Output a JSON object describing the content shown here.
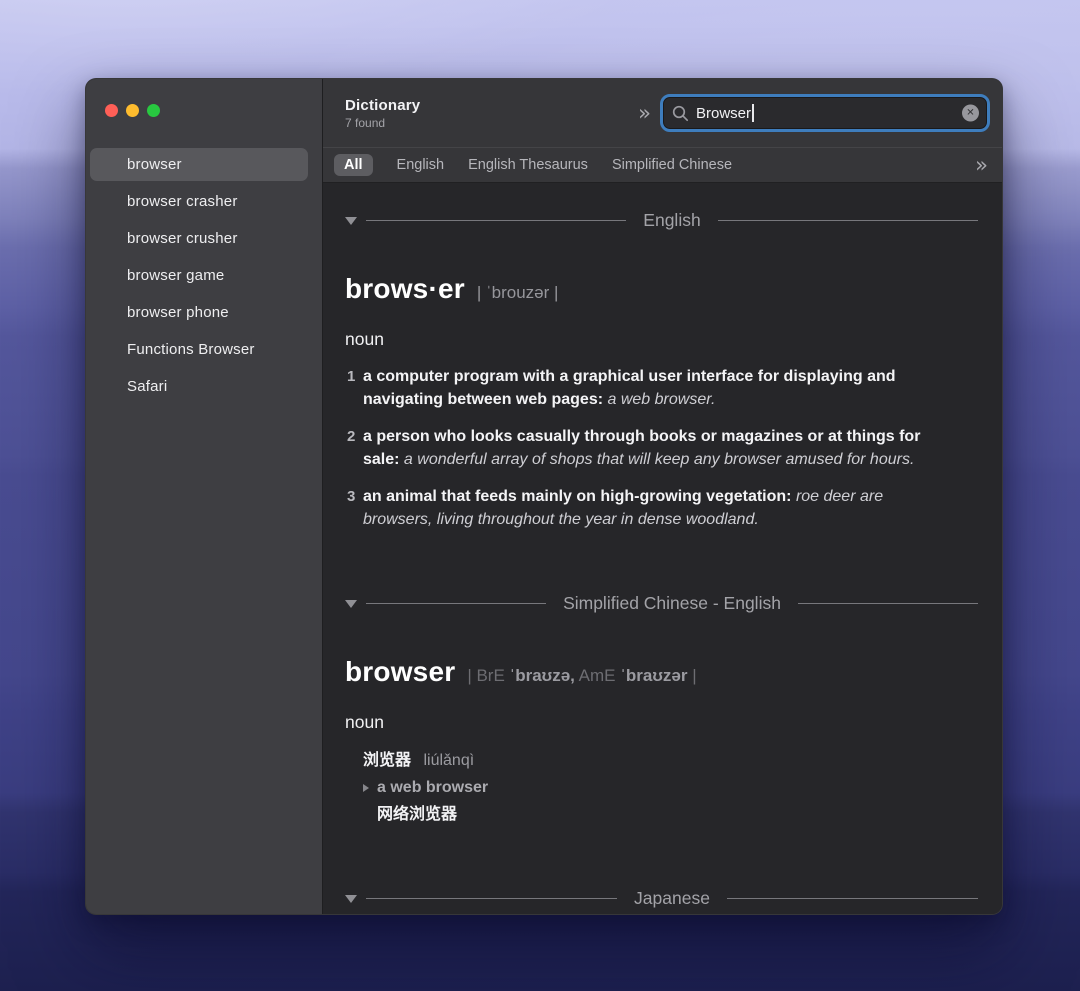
{
  "window": {
    "title": "Dictionary",
    "result_count": "7 found",
    "toolbar_overflow_chevron": "»",
    "search": {
      "value": "Browser",
      "clear_glyph": "✕"
    },
    "colors": {
      "focus_ring": "#3e7dbd",
      "traffic_red": "#ff5f57",
      "traffic_yellow": "#febc2e",
      "traffic_green": "#28c840",
      "sidebar_bg": "#3e3e42",
      "toolbar_bg": "#363639",
      "content_bg": "#262629"
    }
  },
  "sidebar": {
    "items": [
      {
        "label": "browser",
        "selected": true
      },
      {
        "label": "browser crasher",
        "selected": false
      },
      {
        "label": "browser crusher",
        "selected": false
      },
      {
        "label": "browser game",
        "selected": false
      },
      {
        "label": "browser phone",
        "selected": false
      },
      {
        "label": "Functions Browser",
        "selected": false
      },
      {
        "label": "Safari",
        "selected": false
      }
    ]
  },
  "tabs": {
    "items": [
      {
        "label": "All",
        "selected": true
      },
      {
        "label": "English",
        "selected": false
      },
      {
        "label": "English Thesaurus",
        "selected": false
      },
      {
        "label": "Simplified Chinese",
        "selected": false
      }
    ],
    "overflow_chevron": "»"
  },
  "sections": {
    "english": {
      "label": "English",
      "headword": "brows·er",
      "pronunciation": "| ˈbrouzər |",
      "part_of_speech": "noun",
      "definitions": [
        {
          "number": "1",
          "text": "a computer program with a graphical user interface for displaying and navigating between web pages: ",
          "example": "a web browser."
        },
        {
          "number": "2",
          "text": "a person who looks casually through books or magazines or at things for sale: ",
          "example": "a wonderful array of shops that will keep any browser amused for hours."
        },
        {
          "number": "3",
          "text": "an animal that feeds mainly on high-growing vegetation: ",
          "example": "roe deer are browsers, living throughout the year in dense woodland."
        }
      ]
    },
    "chinese": {
      "label": "Simplified Chinese - English",
      "headword": "browser",
      "pron_open": "| ",
      "bre_label": "BrE",
      "bre_ipa": " ˈbraʊzə,",
      "ame_label": "  AmE",
      "ame_ipa": " ˈbraʊzər ",
      "pron_close": "|",
      "part_of_speech": "noun",
      "translation": "浏览器",
      "pinyin": "liúlǎnqì",
      "sub_example": "a web browser",
      "sub_translation": "网络浏览器"
    },
    "japanese": {
      "label": "Japanese"
    }
  }
}
